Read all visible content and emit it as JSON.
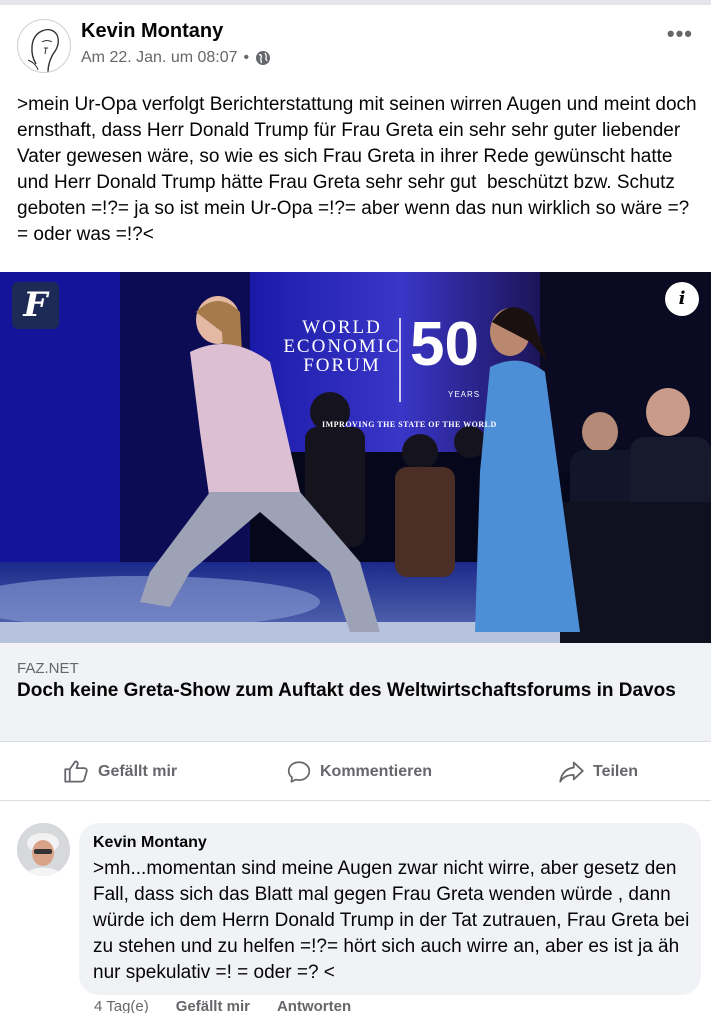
{
  "post": {
    "author": "Kevin Montany",
    "timestamp": "Am 22. Jan. um 08:07",
    "separator": "•",
    "audience_icon": "globe-icon",
    "more_icon": "•••",
    "text": ">mein Ur-Opa verfolgt Berichterstattung mit seinen wirren Augen und meint doch  ernsthaft, dass Herr Donald Trump für Frau Greta ein sehr sehr guter liebender Vater gewesen wäre, so wie es sich Frau Greta in ihrer Rede gewünscht hatte und Herr Donald Trump hätte Frau Greta sehr sehr gut  beschützt bzw. Schutz geboten =!?= ja so ist mein Ur-Opa =!?= aber wenn das nun wirklich so wäre =? = oder was =!?<"
  },
  "link": {
    "info_icon": "i",
    "badge_letter": "F",
    "image_banner_lines": [
      "WORLD",
      "ECONOMIC",
      "FORUM"
    ],
    "image_banner_number": "50",
    "image_banner_years": "YEARS",
    "image_banner_tagline": "IMPROVING THE STATE OF THE WORLD",
    "domain": "FAZ.NET",
    "title": "Doch keine Greta-Show zum Auftakt des Weltwirtschaftsforums in Davos"
  },
  "actions": {
    "like": "Gefällt mir",
    "comment": "Kommentieren",
    "share": "Teilen"
  },
  "comment": {
    "author": "Kevin Montany",
    "text": ">mh...momentan sind meine Augen zwar nicht wirre, aber gesetz den Fall, dass sich das Blatt mal gegen Frau Greta wenden würde , dann würde ich dem Herrn Donald Trump in der Tat zutrauen,  Frau Greta bei  zu stehen und zu helfen =!?= hört sich auch wirre an, aber es ist ja äh nur spekulativ =! = oder =? <",
    "age": "4 Tag(e)",
    "like": "Gefällt mir",
    "reply": "Antworten"
  },
  "colors": {
    "secondary_text": "#65676b",
    "caption_bg": "#f0f2f5",
    "divider": "#dadde1"
  }
}
